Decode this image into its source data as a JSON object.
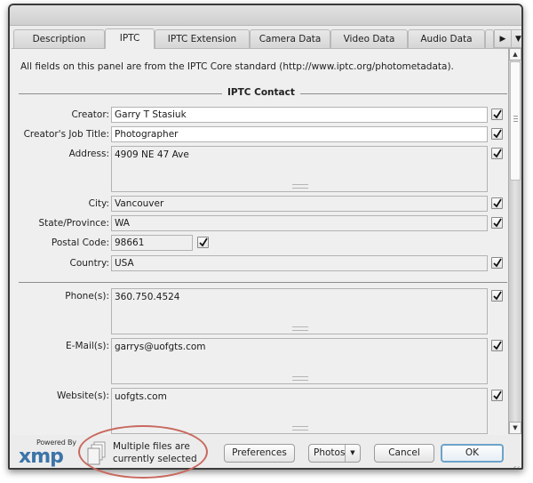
{
  "tabs": [
    {
      "label": "Description",
      "active": false
    },
    {
      "label": "IPTC",
      "active": true
    },
    {
      "label": "IPTC Extension",
      "active": false
    },
    {
      "label": "Camera Data",
      "active": false
    },
    {
      "label": "Video Data",
      "active": false
    },
    {
      "label": "Audio Data",
      "active": false
    }
  ],
  "tab_scroll": {
    "next_icon": "▶",
    "menu_icon": "▼"
  },
  "panel": {
    "info_text": "All fields on this panel are from the IPTC Core standard (http://www.iptc.org/photometadata).",
    "section_title": "IPTC Contact"
  },
  "fields": {
    "creator": {
      "label": "Creator:",
      "value": "Garry T Stasiuk",
      "checked": true
    },
    "job_title": {
      "label": "Creator's Job Title:",
      "value": "Photographer",
      "checked": true
    },
    "address": {
      "label": "Address:",
      "value": "4909 NE 47 Ave",
      "checked": true
    },
    "city": {
      "label": "City:",
      "value": "Vancouver",
      "checked": true
    },
    "state": {
      "label": "State/Province:",
      "value": "WA",
      "checked": true
    },
    "postal": {
      "label": "Postal Code:",
      "value": "98661",
      "checked": true
    },
    "country": {
      "label": "Country:",
      "value": "USA",
      "checked": true
    },
    "phone": {
      "label": "Phone(s):",
      "value": "360.750.4524",
      "checked": true
    },
    "email": {
      "label": "E-Mail(s):",
      "value": "garrys@uofgts.com",
      "checked": true
    },
    "website": {
      "label": "Website(s):",
      "value": "uofgts.com",
      "checked": true
    }
  },
  "scrollbar": {
    "up_icon": "▲",
    "down_icon": "▼"
  },
  "footer": {
    "powered_by": "Powered By",
    "logo_text": "xmp",
    "multi_files_line1": "Multiple files are",
    "multi_files_line2": "currently selected",
    "preferences_label": "Preferences",
    "template_label": "Photos",
    "template_dropdown_icon": "▼",
    "cancel_label": "Cancel",
    "ok_label": "OK"
  },
  "colors": {
    "annotation_ellipse": "#c8695e",
    "xmp_logo": "#3b74a8",
    "ok_focus_ring": "#6da3c9"
  }
}
